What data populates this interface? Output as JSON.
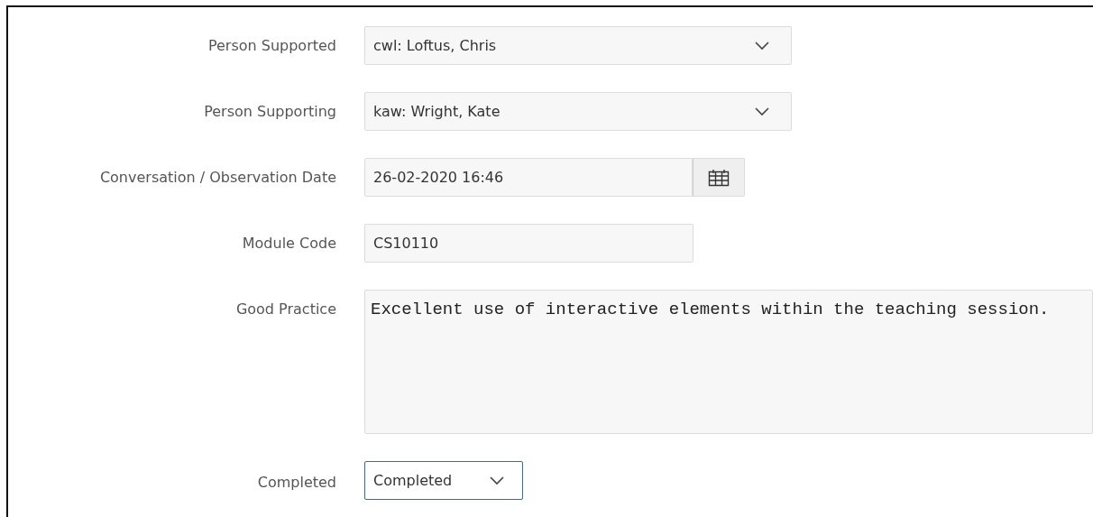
{
  "form": {
    "fields": [
      {
        "label": "Person Supported",
        "kind": "select",
        "value": "cwl: Loftus, Chris",
        "focused": false
      },
      {
        "label": "Person Supporting",
        "kind": "select",
        "value": "kaw: Wright, Kate",
        "focused": false
      },
      {
        "label": "Conversation / Observation Date",
        "kind": "date",
        "value": "26-02-2020 16:46",
        "focused": false
      },
      {
        "label": "Module Code",
        "kind": "text",
        "value": "CS10110",
        "focused": false
      },
      {
        "label": "Good Practice",
        "kind": "textarea",
        "value": "Excellent use of interactive elements within the teaching session.",
        "focused": false
      },
      {
        "label": "Completed",
        "kind": "select",
        "value": "Completed",
        "focused": true
      }
    ]
  }
}
